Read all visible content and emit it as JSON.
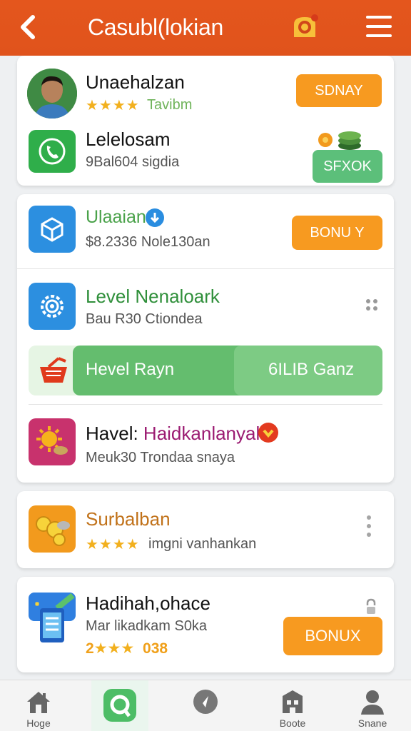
{
  "header": {
    "back_icon": "chevron-left-icon",
    "title": "Casubl(lokian",
    "notification_icon": "bell-badge-icon",
    "menu_icon": "hamburger-menu-icon"
  },
  "profile_card": {
    "name": "Unaehalzan",
    "stars": "★★★★",
    "rating_label": "Tavibm",
    "button_label": "SDNAY",
    "app_name": "Lelelosam",
    "app_sub": "9Bal604 sigdia",
    "app_icon": "phone-icon",
    "app_button_label": "SFXOK",
    "coins_icon": "coin-stack-icon"
  },
  "list_card": {
    "item1": {
      "name": "Ulaaian",
      "sub": "$8.2336 Nole130an",
      "icon": "cube-icon",
      "badge_icon": "download-badge-icon",
      "button_label": "BONU Y"
    },
    "item2": {
      "name": "Level Nenaloark",
      "sub": "Bau R30 Ctiondea",
      "icon": "gear-icon",
      "more_icon": "more-icon"
    },
    "banner": {
      "left_label": "Hevel Rayn",
      "right_label": "6ILIB Ganz",
      "icon": "basket-icon"
    },
    "item3": {
      "name_prefix": "Havel: ",
      "name_highlight": "Haidkanlanyal",
      "sub": "Meuk30 Trondaa snaya",
      "icon": "sun-coin-icon",
      "badge_icon": "heart-badge-icon"
    }
  },
  "card_surbalban": {
    "name": "Surbalban",
    "stars": "★★★★",
    "sub": "imgni vanhankan",
    "icon": "coins-icon",
    "more_icon": "vertical-more-icon"
  },
  "card_hadihah": {
    "name": "Hadihah,ohace",
    "sub": "Mar likadkam S0ka",
    "rating_num": "2",
    "stars": "★★★",
    "rating_value": "038",
    "icon": "phone-app-icon",
    "button_label": "BONUX",
    "lock_icon": "lock-icon"
  },
  "bottom_nav": [
    {
      "label": "Hoge",
      "icon": "home-icon"
    },
    {
      "label": "",
      "icon": "search-chat-icon"
    },
    {
      "label": "",
      "icon": "compass-icon"
    },
    {
      "label": "Boote",
      "icon": "store-icon"
    },
    {
      "label": "Snane",
      "icon": "profile-icon"
    }
  ]
}
